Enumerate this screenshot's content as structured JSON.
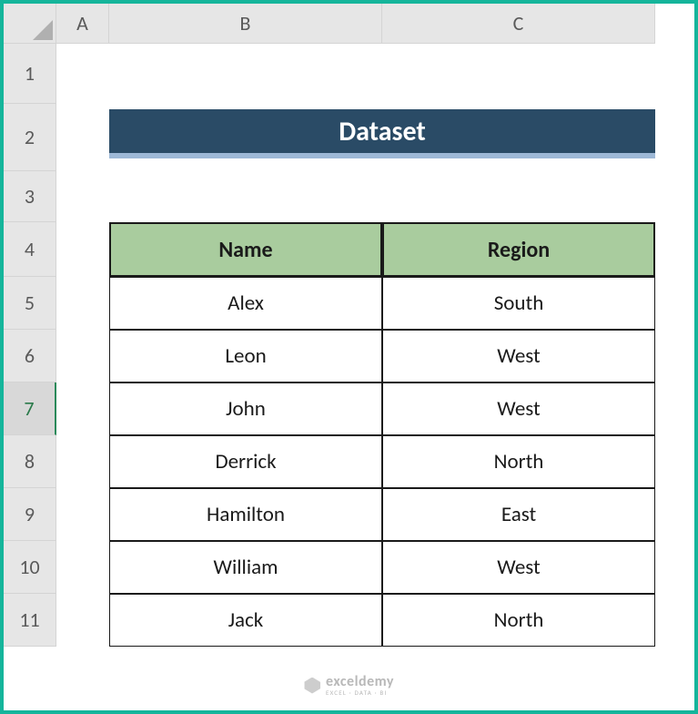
{
  "columns": [
    "A",
    "B",
    "C"
  ],
  "rows": [
    "1",
    "2",
    "3",
    "4",
    "5",
    "6",
    "7",
    "8",
    "9",
    "10",
    "11"
  ],
  "selected_row_index": 6,
  "title": "Dataset",
  "table": {
    "headers": [
      "Name",
      "Region"
    ],
    "data": [
      [
        "Alex",
        "South"
      ],
      [
        "Leon",
        "West"
      ],
      [
        "John",
        "West"
      ],
      [
        "Derrick",
        "North"
      ],
      [
        "Hamilton",
        "East"
      ],
      [
        "William",
        "West"
      ],
      [
        "Jack",
        "North"
      ]
    ]
  },
  "watermark": {
    "name": "exceldemy",
    "tagline": "EXCEL · DATA · BI"
  },
  "colors": {
    "frame": "#15b59b",
    "banner_bg": "#2a4b66",
    "banner_underline": "#9db8d6",
    "header_bg": "#a9cc9e"
  }
}
